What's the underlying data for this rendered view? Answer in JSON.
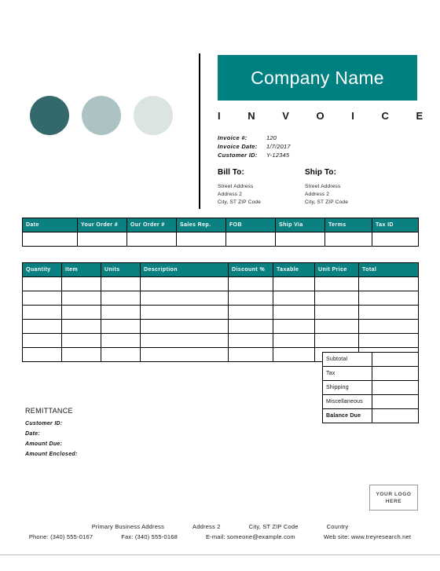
{
  "colors": {
    "brand_teal": "#008080",
    "header_teal": "#0b8080",
    "circle_dark": "#33696b",
    "circle_mid": "#adc2c2",
    "circle_light": "#dce3e3",
    "page_edge": "#b8c0c2"
  },
  "header": {
    "company_name": "Company Name",
    "invoice_word": "I N V O I C E"
  },
  "meta": {
    "rows": [
      {
        "label": "Invoice #:",
        "value": "120"
      },
      {
        "label": "Invoice Date:",
        "value": "1/7/2017"
      },
      {
        "label": "Customer ID:",
        "value": "Y-12345"
      }
    ]
  },
  "bill_to": {
    "title": "Bill To:",
    "lines": [
      "Street Address",
      "Address 2",
      "City, ST  ZIP Code"
    ]
  },
  "ship_to": {
    "title": "Ship To:",
    "lines": [
      "Street Address",
      "Address 2",
      "City, ST  ZIP Code"
    ]
  },
  "order_table": {
    "columns": [
      "Date",
      "Your Order #",
      "Our Order #",
      "Sales Rep.",
      "FOB",
      "Ship Via",
      "Terms",
      "Tax ID"
    ],
    "row_count": 1
  },
  "items_table": {
    "columns": [
      "Quantity",
      "Item",
      "Units",
      "Description",
      "Discount %",
      "Taxable",
      "Unit Price",
      "Total"
    ],
    "row_count": 6
  },
  "totals": {
    "rows": [
      {
        "label": "Subtotal",
        "value": "",
        "bold": false
      },
      {
        "label": "Tax",
        "value": "",
        "bold": false
      },
      {
        "label": "Shipping",
        "value": "",
        "bold": false
      },
      {
        "label": "Miscellaneous",
        "value": "",
        "bold": false
      },
      {
        "label": "Balance Due",
        "value": "",
        "bold": true
      }
    ]
  },
  "remittance": {
    "title": "REMITTANCE",
    "lines": [
      "Customer ID:",
      "Date:",
      "Amount Due:",
      "Amount Enclosed:"
    ]
  },
  "logo": {
    "line1": "YOUR LOGO",
    "line2": "HERE"
  },
  "footer": {
    "line1": [
      "Primary Business Address",
      "Address 2",
      "City, ST  ZIP Code",
      "Country"
    ],
    "line2": [
      "Phone: (340) 555-0167",
      "Fax: (340) 555-0168",
      "E-mail: someone@example.com",
      "Web site: www.treyresearch.net"
    ]
  }
}
